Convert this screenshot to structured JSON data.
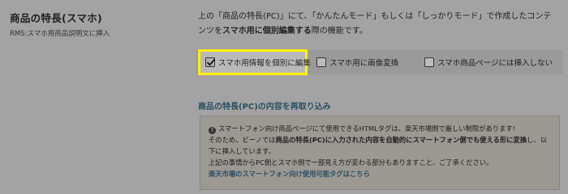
{
  "section": {
    "title": "商品の特長(スマホ)",
    "subtitle": "RMS:スマホ用商品説明文に挿入"
  },
  "description": {
    "part1": "上の「商品の特長(PC)」にて、「かんたんモード」もしくは「しっかりモード」で作成したコンテンツを",
    "bold1": "スマホ用に個別編集する",
    "part2": "際の機能です。"
  },
  "options": [
    {
      "label": "スマホ用情報を個別に編集",
      "checked": true
    },
    {
      "label": "スマホ用に画像変換",
      "checked": false
    },
    {
      "label": "スマホ商品ページには挿入しない",
      "checked": false
    }
  ],
  "reimport_link": "商品の特長(PC)の内容を再取り込み",
  "notice": {
    "line1": "スマートフォン向け商品ページにて使用できるHTMLタグは、楽天市場側で厳しい制限があります!",
    "line2a": "そのため、ビーノでは",
    "line2b": "商品の特長(PC)に入力された内容を自動的にスマートフォン側でも使える形に変換",
    "line2c": "し、以下に挿入しています。",
    "line3": "上記の事情からPC側とスマホ側で一部見え方が変わる部分もありますこと、ご了承ください。",
    "link": "楽天市場のスマートフォン向け使用可能タグはこちら"
  }
}
